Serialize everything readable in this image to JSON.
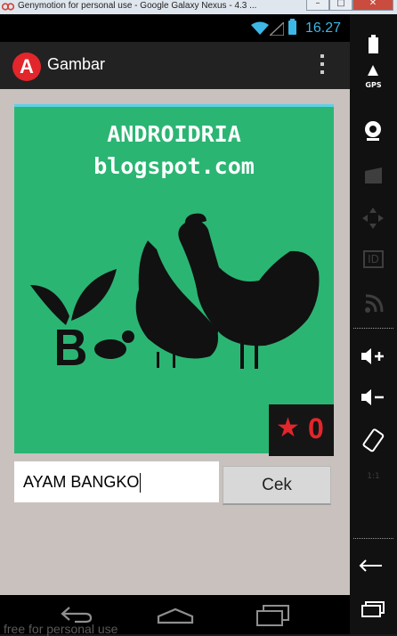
{
  "window": {
    "title": "Genymotion for personal use - Google Galaxy Nexus - 4.3 ..."
  },
  "statusbar": {
    "time": "16.27"
  },
  "app": {
    "title": "Gambar"
  },
  "picture": {
    "watermark_line1": "ANDROIDRIA",
    "watermark_line2": "blogspot.com",
    "badge_star": "★",
    "badge_count": "0"
  },
  "answer_input": {
    "value": "AYAM BANGKO"
  },
  "check_button": {
    "label": "Cek"
  },
  "footer": {
    "watermark": "free for personal use"
  },
  "sidebar": {
    "gps_label": "GPS",
    "id_label": "ID",
    "rotate_label": "1:1"
  },
  "colors": {
    "accent": "#3db7e6",
    "picture_bg": "#2bb573",
    "badge_red": "#e2262b"
  }
}
